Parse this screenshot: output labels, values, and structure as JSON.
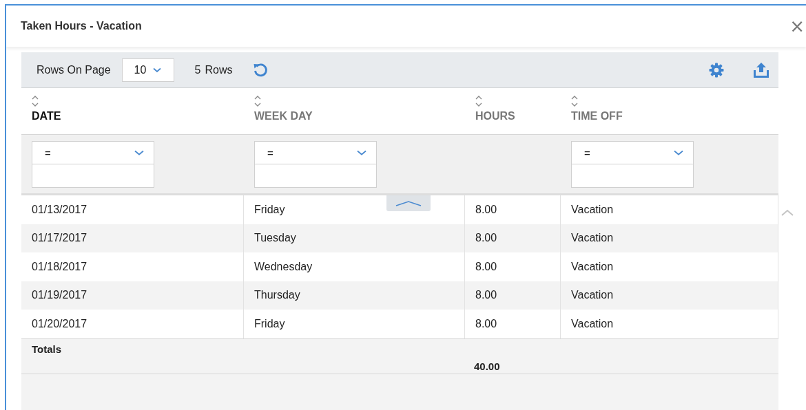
{
  "window": {
    "title": "Taken Hours - Vacation",
    "close": "×"
  },
  "toolbar": {
    "rows_on_page_label": "Rows On Page",
    "rows_on_page_value": "10",
    "row_count": "5",
    "row_count_label": "Rows"
  },
  "table": {
    "columns": [
      {
        "label": "DATE",
        "sorted": true,
        "filter": {
          "operator": "="
        }
      },
      {
        "label": "WEEK DAY",
        "sorted": false,
        "filter": {
          "operator": "="
        }
      },
      {
        "label": "HOURS",
        "sorted": false
      },
      {
        "label": "TIME OFF",
        "sorted": false,
        "filter": {
          "operator": "="
        }
      }
    ],
    "rows": [
      [
        "01/13/2017",
        "Friday",
        "8.00",
        "Vacation"
      ],
      [
        "01/17/2017",
        "Tuesday",
        "8.00",
        "Vacation"
      ],
      [
        "01/18/2017",
        "Wednesday",
        "8.00",
        "Vacation"
      ],
      [
        "01/19/2017",
        "Thursday",
        "8.00",
        "Vacation"
      ],
      [
        "01/20/2017",
        "Friday",
        "8.00",
        "Vacation"
      ]
    ],
    "totals": {
      "label": "Totals",
      "hours": "40.00"
    }
  }
}
